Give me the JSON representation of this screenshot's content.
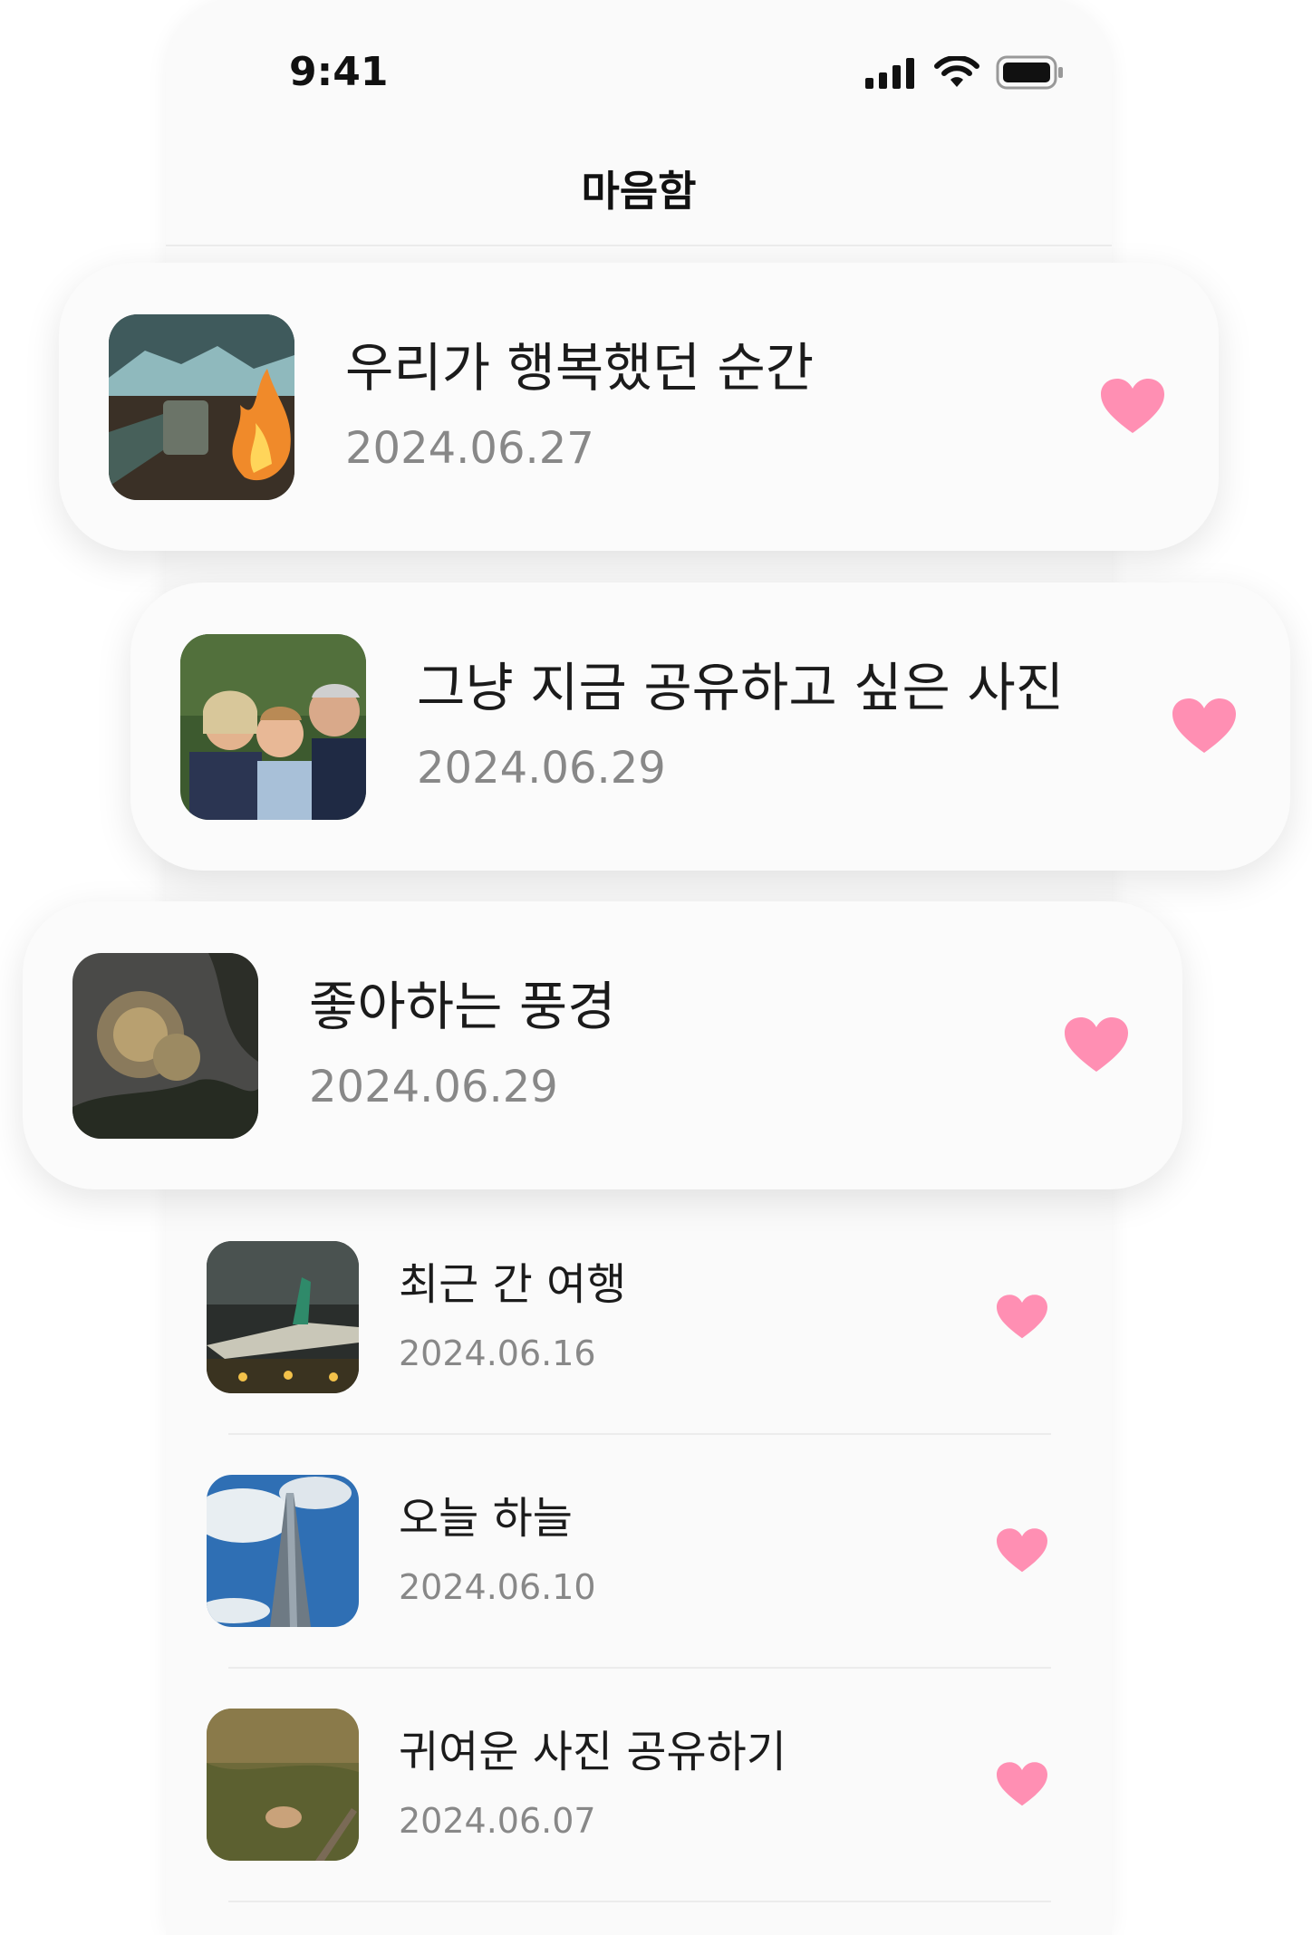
{
  "status_bar": {
    "time": "9:41"
  },
  "header": {
    "title": "마음함"
  },
  "accent_color": "#ff8fb3",
  "featured_items": [
    {
      "title": "우리가 행복했던 순간",
      "date": "2024.06.27",
      "thumbnail": "campfire-mug-photo"
    },
    {
      "title": "그냥 지금 공유하고 싶은 사진",
      "date": "2024.06.29",
      "thumbnail": "family-photo"
    },
    {
      "title": "좋아하는 풍경",
      "date": "2024.06.29",
      "thumbnail": "fireworks-photo"
    }
  ],
  "list_items": [
    {
      "title": "최근 간 여행",
      "date": "2024.06.16",
      "thumbnail": "airplane-night-photo"
    },
    {
      "title": "오늘 하늘",
      "date": "2024.06.10",
      "thumbnail": "sky-tower-photo"
    },
    {
      "title": "귀여운 사진 공유하기",
      "date": "2024.06.07",
      "thumbnail": "cat-grass-photo"
    }
  ]
}
